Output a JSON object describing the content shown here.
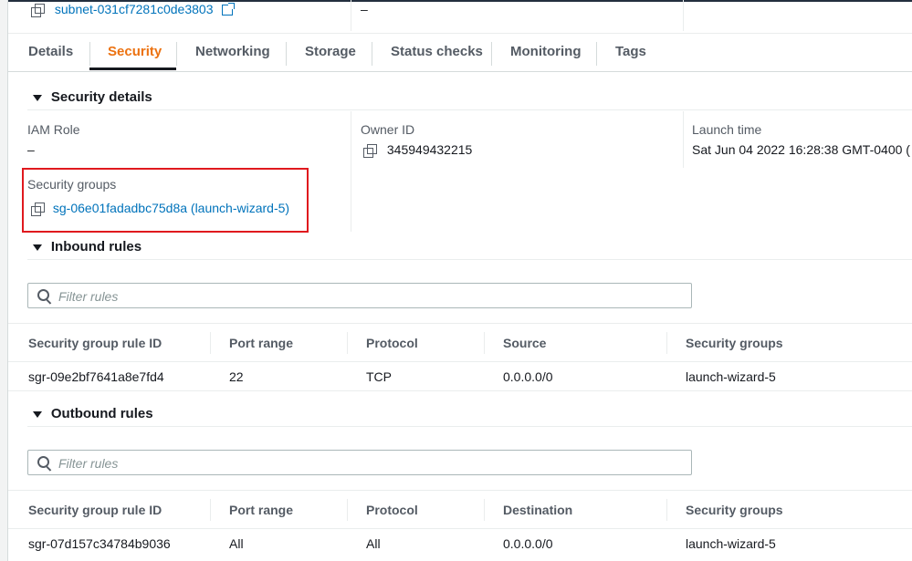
{
  "top": {
    "subnet_link": "subnet-031cf7281c0de3803",
    "right_value": "–"
  },
  "tabs": [
    {
      "label": "Details",
      "active": false
    },
    {
      "label": "Security",
      "active": true
    },
    {
      "label": "Networking",
      "active": false
    },
    {
      "label": "Storage",
      "active": false
    },
    {
      "label": "Status checks",
      "active": false
    },
    {
      "label": "Monitoring",
      "active": false
    },
    {
      "label": "Tags",
      "active": false
    }
  ],
  "security_details": {
    "title": "Security details",
    "iam_role_label": "IAM Role",
    "iam_role_value": "–",
    "owner_id_label": "Owner ID",
    "owner_id_value": "345949432215",
    "launch_time_label": "Launch time",
    "launch_time_value": "Sat Jun 04 2022 16:28:38 GMT-0400 (",
    "security_groups_label": "Security groups",
    "security_groups_link": "sg-06e01fadadbc75d8a (launch-wizard-5)"
  },
  "inbound": {
    "title": "Inbound rules",
    "filter_placeholder": "Filter rules",
    "columns": [
      "Security group rule ID",
      "Port range",
      "Protocol",
      "Source",
      "Security groups"
    ],
    "rows": [
      [
        "sgr-09e2bf7641a8e7fd4",
        "22",
        "TCP",
        "0.0.0.0/0",
        "launch-wizard-5"
      ]
    ]
  },
  "outbound": {
    "title": "Outbound rules",
    "filter_placeholder": "Filter rules",
    "columns": [
      "Security group rule ID",
      "Port range",
      "Protocol",
      "Destination",
      "Security groups"
    ],
    "rows": [
      [
        "sgr-07d157c34784b9036",
        "All",
        "All",
        "0.0.0.0/0",
        "launch-wizard-5"
      ]
    ]
  },
  "colors": {
    "active_tab": "#ec7211",
    "link": "#0073bb",
    "highlight": "#e0191e"
  },
  "icons": [
    "copy-icon",
    "external-link-icon",
    "caret-down-icon",
    "search-icon"
  ]
}
